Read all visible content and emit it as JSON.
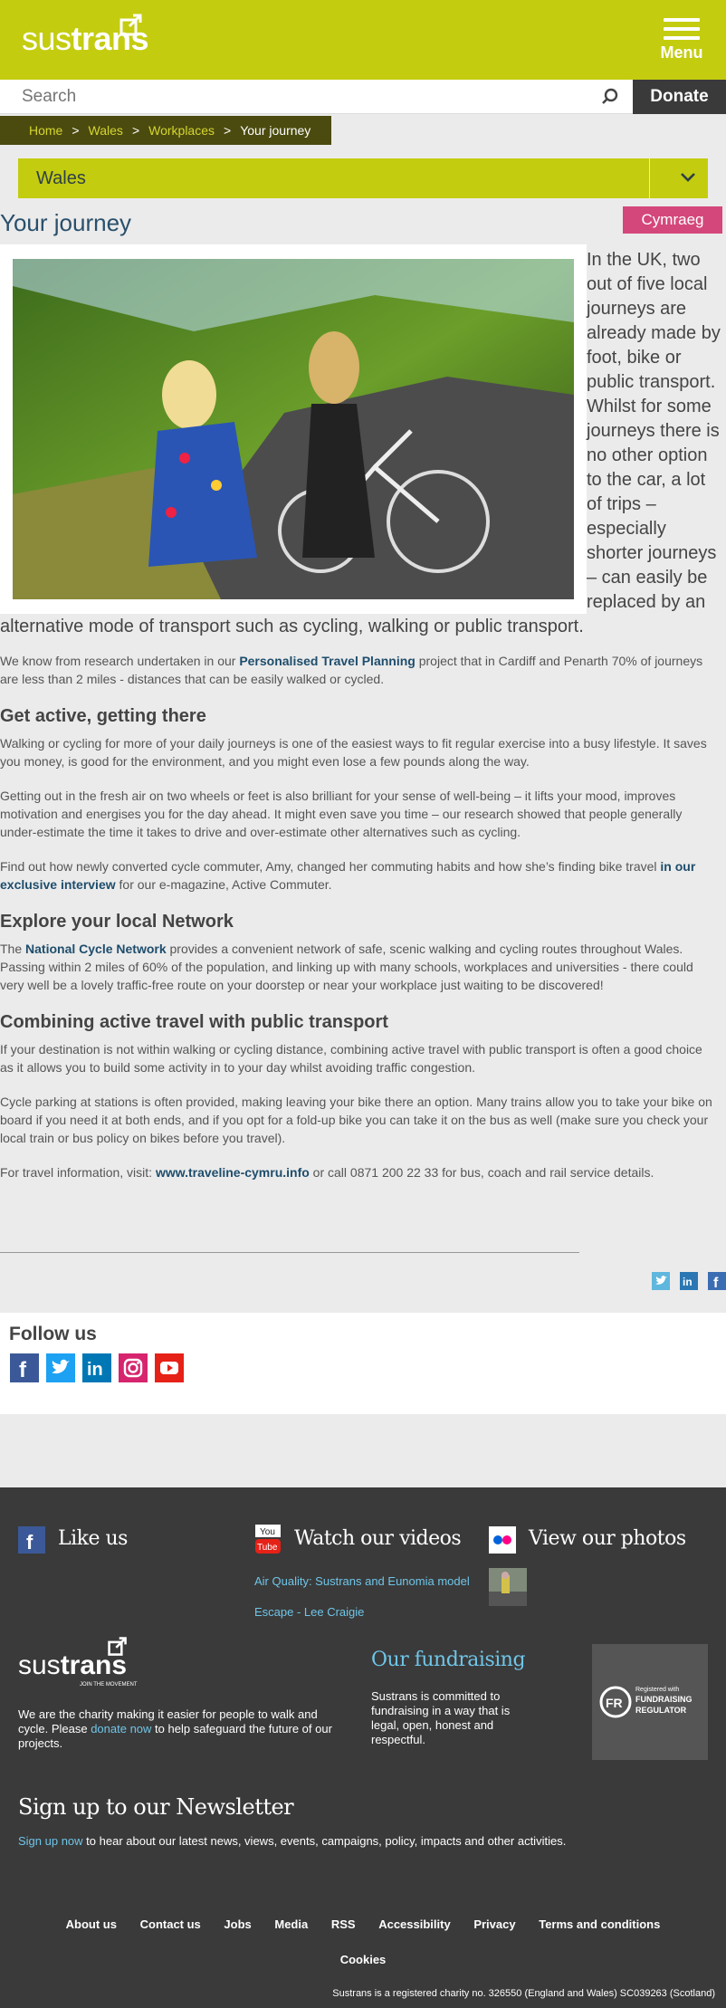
{
  "header": {
    "logo_text_bold": "sus",
    "logo_text_light": "trans",
    "menu_label": "Menu",
    "search_placeholder": "Search",
    "donate_label": "Donate"
  },
  "breadcrumb": [
    "Home",
    "Wales",
    "Workplaces",
    "Your journey"
  ],
  "region": {
    "label": "Wales"
  },
  "page": {
    "title": "Your journey",
    "language_button": "Cymraeg",
    "lead": "In the UK, two out of five local journeys are already made by foot, bike or public transport.  Whilst for some journeys there is no other option to the car, a lot of trips – especially shorter journeys – can easily be replaced by an alternative mode of transport such as cycling, walking or public transport.",
    "p1_before": "We know from research undertaken in our ",
    "p1_link": "Personalised Travel Planning",
    "p1_after": " project that in Cardiff and Penarth 70% of journeys are less than 2 miles - distances that can be easily walked or cycled.",
    "h_get_active": "Get active, getting there",
    "p2": "Walking or cycling for more of your daily journeys is one of the easiest ways to fit regular exercise into a busy lifestyle. It saves you money, is good for the environment, and you might even lose a few pounds along the way.",
    "p3": "Getting out in the fresh air on two wheels or feet is also brilliant for your sense of well-being – it lifts your mood, improves motivation and energises you for the day ahead. It might even save you time – our research showed that people generally under-estimate the time it takes to drive and over-estimate other alternatives such as cycling.",
    "p4_before": "Find out how newly converted cycle commuter, Amy, changed her commuting habits and how she’s finding bike travel ",
    "p4_link": "in our exclusive interview",
    "p4_after": " for our e-magazine, Active Commuter.",
    "h_network": "Explore your local Network",
    "p5_before": "The ",
    "p5_link": "National Cycle Network",
    "p5_after": " provides a convenient network of safe, scenic walking and cycling routes throughout Wales. Passing within 2 miles of 60% of the population, and linking up with many schools, workplaces and universities - there could very well be a lovely traffic-free route on your doorstep or near your workplace just waiting to be discovered!",
    "h_combining": "Combining active travel with public transport",
    "p6": "If your destination is not within walking or cycling distance, combining active travel with public transport is often a good choice as it allows you to build some activity in to your day whilst avoiding traffic congestion.",
    "p7": "Cycle parking at stations is often provided, making leaving your bike there an option. Many trains allow you to take your bike on board if you need it at both ends, and if you opt for a fold-up bike you can take it on the bus as well (make sure you check your local train or bus policy on bikes before you travel).",
    "p8_before": "For travel information, visit: ",
    "p8_link": "www.traveline-cymru.info",
    "p8_after": " or call 0871 200 22 33 for bus, coach and rail service details."
  },
  "follow": {
    "title": "Follow us"
  },
  "footer": {
    "like_us": "Like us",
    "watch_videos": "Watch our videos",
    "video_1": "Air Quality: Sustrans and Eunomia model",
    "video_2": "Escape - Lee Craigie",
    "view_photos": "View our photos",
    "youtube_top": "You",
    "youtube_bottom": "Tube",
    "charity_before": "We are the charity making it easier for people to walk and cycle. Please ",
    "charity_link": "donate now",
    "charity_after": " to help safeguard the future of our projects.",
    "logo_tagline": "JOIN THE MOVEMENT",
    "fundraising_title": "Our fundraising",
    "fundraising_text": "Sustrans is committed to fundraising in a way that is legal, open, honest and respectful.",
    "fr_badge_small": "Registered with",
    "fr_badge_big1": "FUNDRAISING",
    "fr_badge_big2": "REGULATOR",
    "newsletter_title": "Sign up to our Newsletter",
    "newsletter_link": "Sign up now",
    "newsletter_text": " to hear about our latest news, views, events, campaigns, policy, impacts and other activities.",
    "links": [
      "About us",
      "Contact us",
      "Jobs",
      "Media",
      "RSS",
      "Accessibility",
      "Privacy",
      "Terms and conditions",
      "Cookies"
    ],
    "registered": "Sustrans is a registered charity no. 326550 (England and Wales) SC039263 (Scotland)"
  },
  "colors": {
    "brand_green": "#c4cc10",
    "dark_olive": "#4b4b0f",
    "title_blue": "#294f6b",
    "link_blue": "#1e4d6c",
    "cymraeg_pink": "#d4477a",
    "footer_bg": "#3a3a3a",
    "footer_link": "#6fc5e8"
  }
}
